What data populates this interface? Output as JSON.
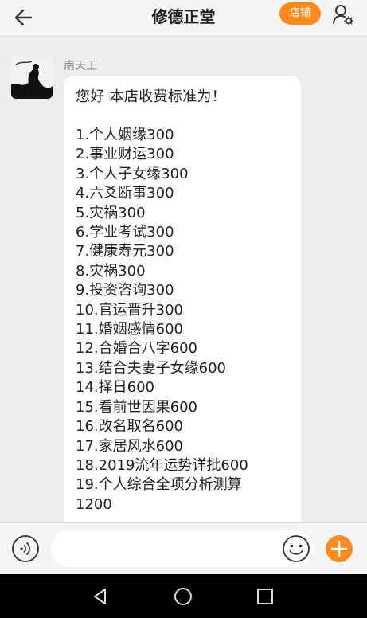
{
  "header": {
    "title": "修德正堂",
    "shop_label": "店铺"
  },
  "message": {
    "sender": "南天王",
    "greeting": "您好 本店收费标准为！",
    "items": [
      "1.个人姻缘300",
      "2.事业财运300",
      "3.个人子女缘300",
      "4.六爻断事300",
      "5.灾祸300",
      "6.学业考试300",
      "7.健康寿元300",
      "8.灾祸300",
      "9.投资咨询300",
      "10.官运晋升300",
      "11.婚姻感情600",
      "12.合婚合八字600",
      "13.结合夫妻子女缘600",
      "14.择日600",
      "15.看前世因果600",
      "16.改名取名600",
      "17.家居风水600",
      "18.2019流年运势详批600",
      "19.个人综合全项分析测算",
      "1200"
    ]
  },
  "input": {
    "value": "",
    "placeholder": ""
  },
  "icons": {
    "back": "arrow-left-icon",
    "user_settings": "user-gear-icon",
    "voice": "voice-icon",
    "emoji": "smiley-icon",
    "plus": "plus-icon",
    "nav_back": "triangle-back-icon",
    "nav_home": "circle-home-icon",
    "nav_recent": "square-recent-icon"
  },
  "colors": {
    "accent": "#ff8a1f",
    "background": "#ededed",
    "bubble": "#ffffff"
  }
}
